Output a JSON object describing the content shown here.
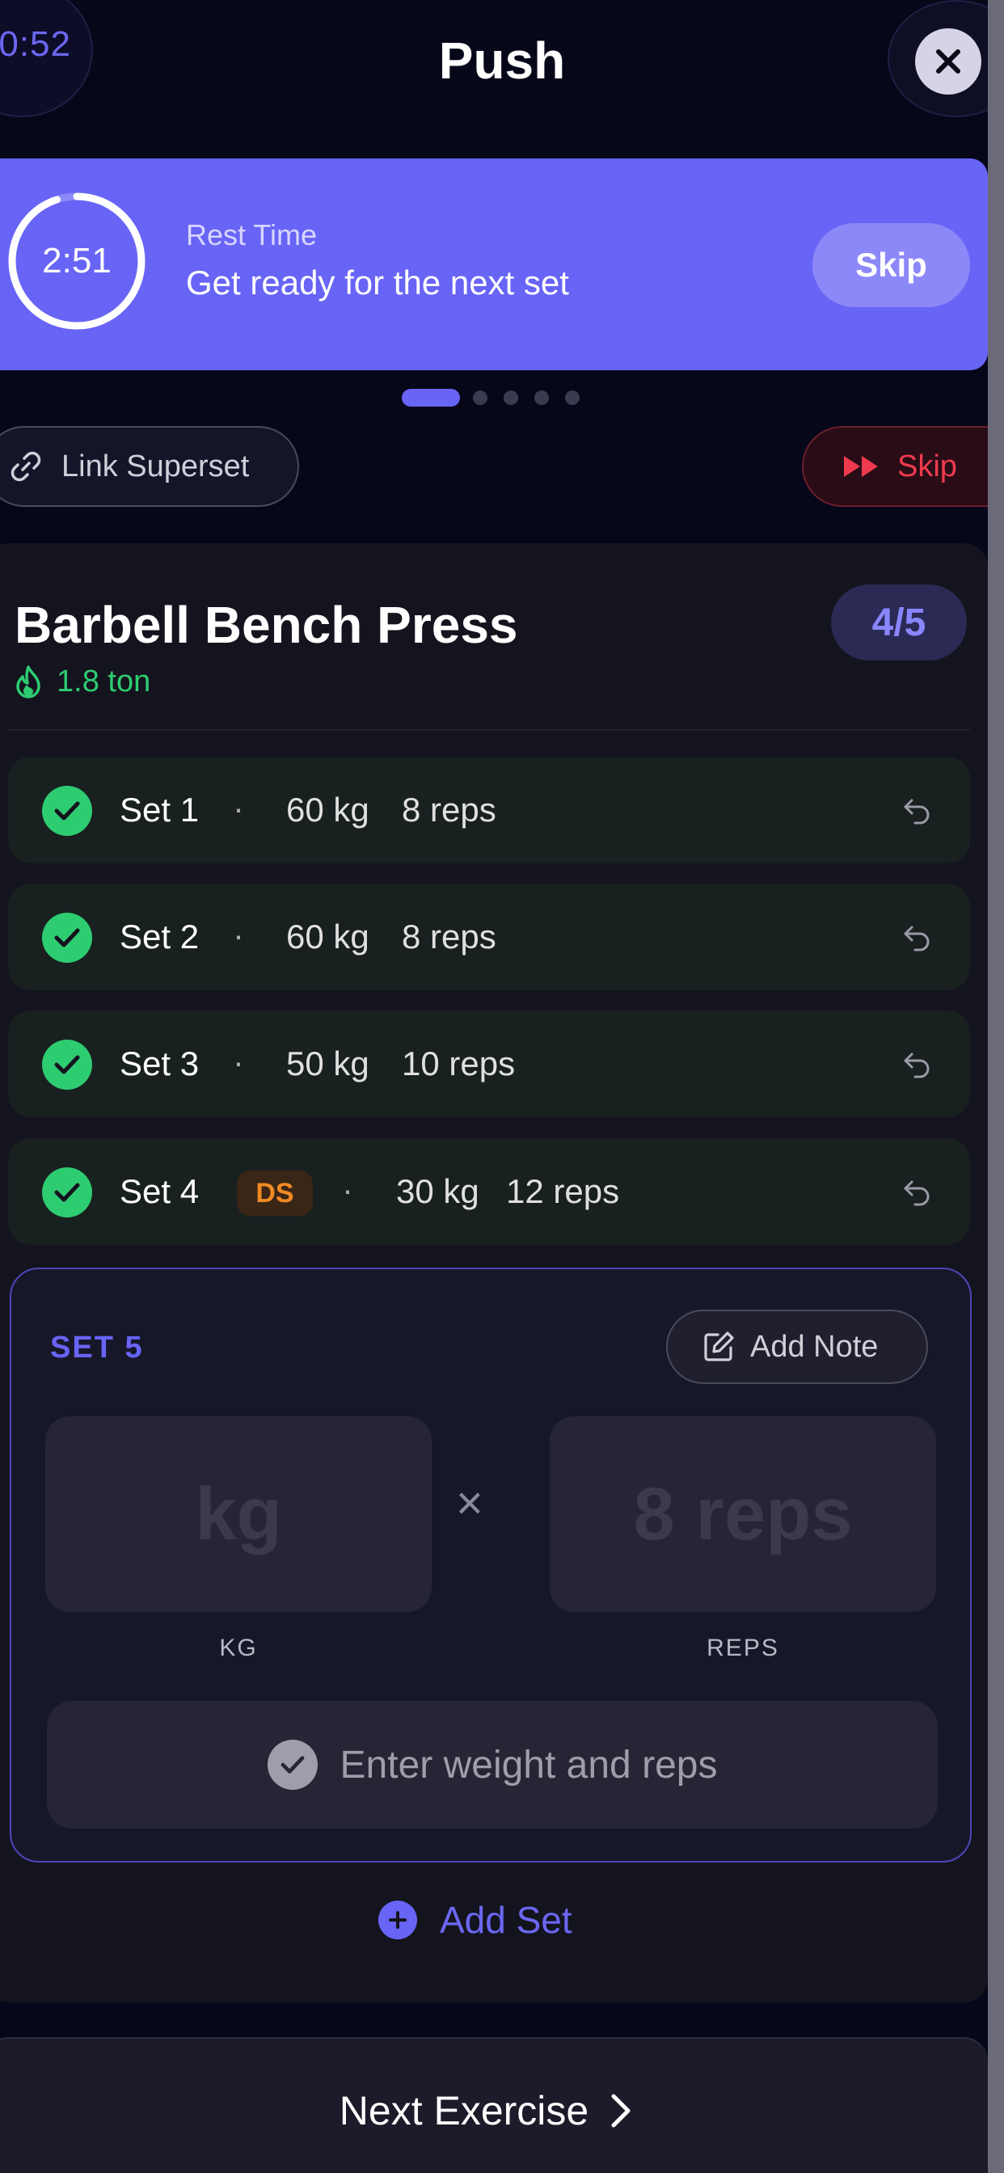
{
  "header": {
    "elapsed": "0:52",
    "title": "Push"
  },
  "rest": {
    "countdown": "2:51",
    "label": "Rest Time",
    "subtitle": "Get ready for the next set",
    "skip_label": "Skip",
    "progress_fraction": 0.95
  },
  "pager": {
    "count": 5,
    "active": 0
  },
  "actions": {
    "superset_label": "Link Superset",
    "skip_label": "Skip"
  },
  "exercise": {
    "name": "Barbell Bench Press",
    "volume": "1.8 ton",
    "progress": "4/5",
    "sets": [
      {
        "label": "Set 1",
        "sep": "·",
        "weight": "60 kg",
        "reps": "8 reps"
      },
      {
        "label": "Set 2",
        "sep": "·",
        "weight": "60 kg",
        "reps": "8 reps"
      },
      {
        "label": "Set 3",
        "sep": "·",
        "weight": "50 kg",
        "reps": "10 reps"
      },
      {
        "label": "Set 4",
        "badge": "DS",
        "sep": "·",
        "weight": "30 kg",
        "reps": "12 reps"
      }
    ]
  },
  "active_set": {
    "title": "SET 5",
    "note_label": "Add Note",
    "kg_placeholder": "kg",
    "times": "×",
    "reps_placeholder": "8 reps",
    "kg_caption": "KG",
    "reps_caption": "REPS",
    "log_label": "Enter weight and reps"
  },
  "add_set_label": "Add Set",
  "next_label": "Next Exercise",
  "colors": {
    "accent": "#6864f6",
    "success": "#2ecc71",
    "danger": "#ef3a4e",
    "dropset": "#f08a24",
    "background": "#07071a"
  }
}
